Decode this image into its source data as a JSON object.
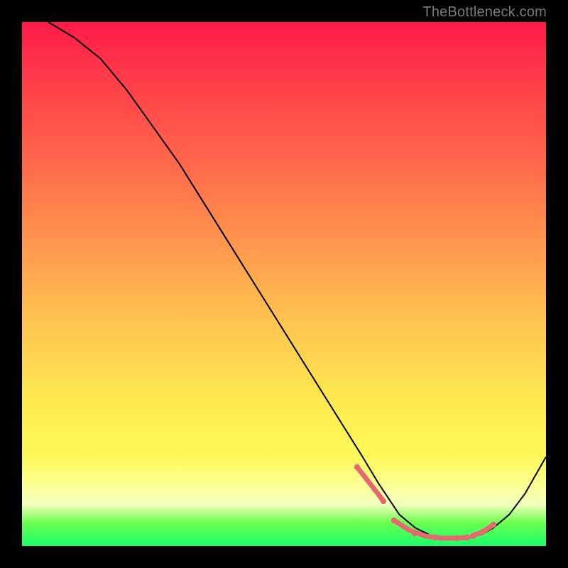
{
  "watermark": "TheBottleneck.com",
  "chart_data": {
    "type": "line",
    "title": "",
    "xlabel": "",
    "ylabel": "",
    "xlim": [
      0,
      100
    ],
    "ylim": [
      0,
      100
    ],
    "grid": false,
    "legend": false,
    "series": [
      {
        "name": "curve",
        "x": [
          5,
          10,
          15,
          20,
          25,
          30,
          35,
          40,
          45,
          50,
          55,
          60,
          65,
          68,
          70,
          72,
          75,
          78,
          80,
          83,
          86,
          88,
          90,
          93,
          96,
          100
        ],
        "y": [
          100,
          97,
          93,
          87,
          80,
          73,
          65,
          57,
          49,
          41,
          33,
          25,
          17,
          12,
          9,
          6,
          3.5,
          2,
          1.5,
          1.5,
          1.7,
          2.3,
          3.5,
          6,
          10,
          17
        ]
      }
    ],
    "annotations": {
      "pink_segments_x_ranges": [
        [
          64,
          69
        ],
        [
          71,
          85
        ],
        [
          86,
          90
        ]
      ],
      "pink_segment_y": 2
    },
    "colors": {
      "curve": "#000000",
      "highlight": "#e56a70",
      "gradient_top": "#ff1a49",
      "gradient_mid": "#fde94f",
      "gradient_bottom": "#19ff6a",
      "frame": "#000000"
    }
  }
}
